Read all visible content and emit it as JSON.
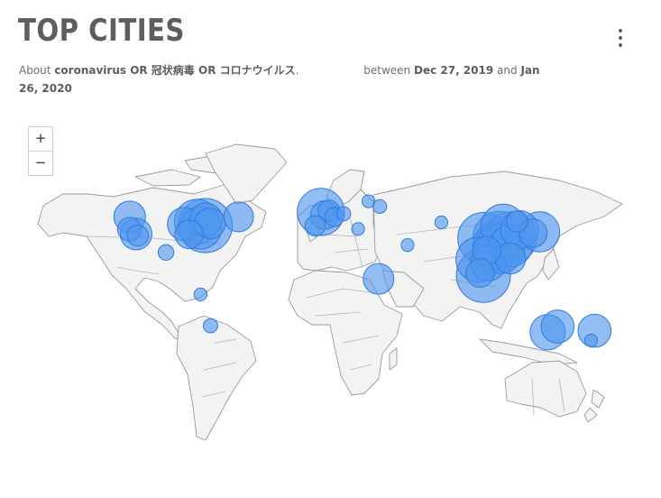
{
  "header": {
    "title": "TOP CITIES",
    "about_prefix": "About",
    "query": "coronavirus OR 冠状病毒 OR コロナウイルス",
    "query_suffix": ".",
    "between": "between",
    "start_date": "Dec 27, 2019",
    "and": "and",
    "end_date": "Jan 26, 2020"
  },
  "zoom": {
    "in_label": "+",
    "out_label": "−"
  },
  "colors": {
    "land": "#f3f3f3",
    "border": "#9a9a9a",
    "bubble_fill": "#4f96ef",
    "bubble_stroke": "#2e7ae0"
  },
  "cities": [
    {
      "lon": -74,
      "lat": 40.7,
      "size": 1.0
    },
    {
      "lon": -79.4,
      "lat": 43.7,
      "size": 0.8
    },
    {
      "lon": -77,
      "lat": 38.9,
      "size": 0.75
    },
    {
      "lon": -87.6,
      "lat": 41.9,
      "size": 0.55
    },
    {
      "lon": -71,
      "lat": 42.4,
      "size": 0.5
    },
    {
      "lon": -84.4,
      "lat": 33.7,
      "size": 0.45
    },
    {
      "lon": -73.6,
      "lat": 45.5,
      "size": 0.55
    },
    {
      "lon": -122.3,
      "lat": 47.6,
      "size": 0.52
    },
    {
      "lon": -122.4,
      "lat": 37.8,
      "size": 0.35
    },
    {
      "lon": -118.2,
      "lat": 34.0,
      "size": 0.52
    },
    {
      "lon": -117.2,
      "lat": 32.7,
      "size": 0.3
    },
    {
      "lon": -99.1,
      "lat": 19.4,
      "size": 0.18
    },
    {
      "lon": -52.7,
      "lat": 47.6,
      "size": 0.48
    },
    {
      "lon": -77,
      "lat": -12,
      "size": 0.12
    },
    {
      "lon": -70.6,
      "lat": -33.4,
      "size": 0.15
    },
    {
      "lon": -0.1,
      "lat": 51.5,
      "size": 0.85
    },
    {
      "lon": 2.3,
      "lat": 48.9,
      "size": 0.45
    },
    {
      "lon": 4.9,
      "lat": 52.4,
      "size": 0.3
    },
    {
      "lon": 8.5,
      "lat": 47.4,
      "size": 0.25
    },
    {
      "lon": -3.7,
      "lat": 40.4,
      "size": 0.28
    },
    {
      "lon": 14.4,
      "lat": 50.1,
      "size": 0.15
    },
    {
      "lon": 30.3,
      "lat": 59.9,
      "size": 0.12
    },
    {
      "lon": 23.7,
      "lat": 38.0,
      "size": 0.12
    },
    {
      "lon": 37.6,
      "lat": 55.8,
      "size": 0.14
    },
    {
      "lon": 55.3,
      "lat": 25.3,
      "size": 0.12
    },
    {
      "lon": 36.8,
      "lat": -1.3,
      "size": 0.5
    },
    {
      "lon": 76.9,
      "lat": 43.2,
      "size": 0.12
    },
    {
      "lon": 104,
      "lat": 30.6,
      "size": 0.95
    },
    {
      "lon": 114.3,
      "lat": 30.6,
      "size": 1.0
    },
    {
      "lon": 116.4,
      "lat": 39.9,
      "size": 0.8
    },
    {
      "lon": 121.5,
      "lat": 31.2,
      "size": 0.95
    },
    {
      "lon": 113.3,
      "lat": 23.1,
      "size": 0.95
    },
    {
      "lon": 114.2,
      "lat": 22.3,
      "size": 0.9
    },
    {
      "lon": 121.5,
      "lat": 25.0,
      "size": 0.75
    },
    {
      "lon": 126.9,
      "lat": 37.6,
      "size": 0.65
    },
    {
      "lon": 139.7,
      "lat": 35.7,
      "size": 0.7
    },
    {
      "lon": 135.5,
      "lat": 34.7,
      "size": 0.45
    },
    {
      "lon": 100.5,
      "lat": 13.8,
      "size": 0.8
    },
    {
      "lon": 103.8,
      "lat": 1.3,
      "size": 1.0
    },
    {
      "lon": 106.8,
      "lat": 10.8,
      "size": 0.6
    },
    {
      "lon": 105.8,
      "lat": 21.0,
      "size": 0.45
    },
    {
      "lon": 101.7,
      "lat": 3.1,
      "size": 0.45
    },
    {
      "lon": 120.9,
      "lat": 14.6,
      "size": 0.5
    },
    {
      "lon": 125.3,
      "lat": 43.9,
      "size": 0.3
    },
    {
      "lon": 151.2,
      "lat": -33.9,
      "size": 0.55
    },
    {
      "lon": 144.9,
      "lat": -37.8,
      "size": 0.6
    },
    {
      "lon": 174.8,
      "lat": -36.8,
      "size": 0.55
    },
    {
      "lon": 172.6,
      "lat": -43.5,
      "size": 0.12
    }
  ]
}
